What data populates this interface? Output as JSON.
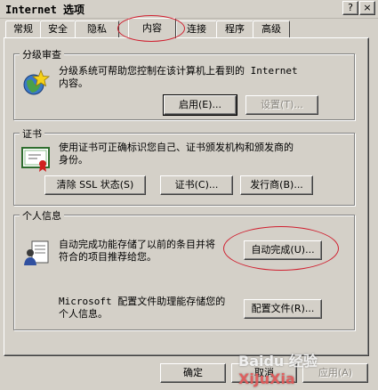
{
  "window": {
    "title": "Internet 选项",
    "help_button": "?",
    "close_button": "×"
  },
  "tabs": [
    {
      "label": "常规"
    },
    {
      "label": "安全"
    },
    {
      "label": "隐私"
    },
    {
      "label": "内容",
      "active": true
    },
    {
      "label": "连接"
    },
    {
      "label": "程序"
    },
    {
      "label": "高级"
    }
  ],
  "content_advisor": {
    "title": "分级审查",
    "description_line1": "分级系统可帮助您控制在该计算机上看到的 Internet",
    "description_line2": "内容。",
    "enable_button": "启用(E)...",
    "settings_button": "设置(T)..."
  },
  "certificates": {
    "title": "证书",
    "description_line1": "使用证书可正确标识您自己、证书颁发机构和颁发商的",
    "description_line2": "身份。",
    "clear_ssl_button": "清除 SSL 状态(S)",
    "certificates_button": "证书(C)...",
    "publishers_button": "发行商(B)..."
  },
  "personal_info": {
    "title": "个人信息",
    "autocomplete_line1": "自动完成功能存储了以前的条目并将",
    "autocomplete_line2": "符合的项目推荐给您。",
    "autocomplete_button": "自动完成(U)...",
    "profile_line1": "Microsoft 配置文件助理能存储您的",
    "profile_line2": "个人信息。",
    "profile_button": "配置文件(R)..."
  },
  "footer": {
    "ok_button": "确定",
    "cancel_button": "取消",
    "apply_button": "应用(A)"
  },
  "watermark": {
    "text_left": "Baidu 经验",
    "text_right": "XiJuXia"
  },
  "colors": {
    "face": "#d4d0c8",
    "annotation_red": "#d02030"
  }
}
